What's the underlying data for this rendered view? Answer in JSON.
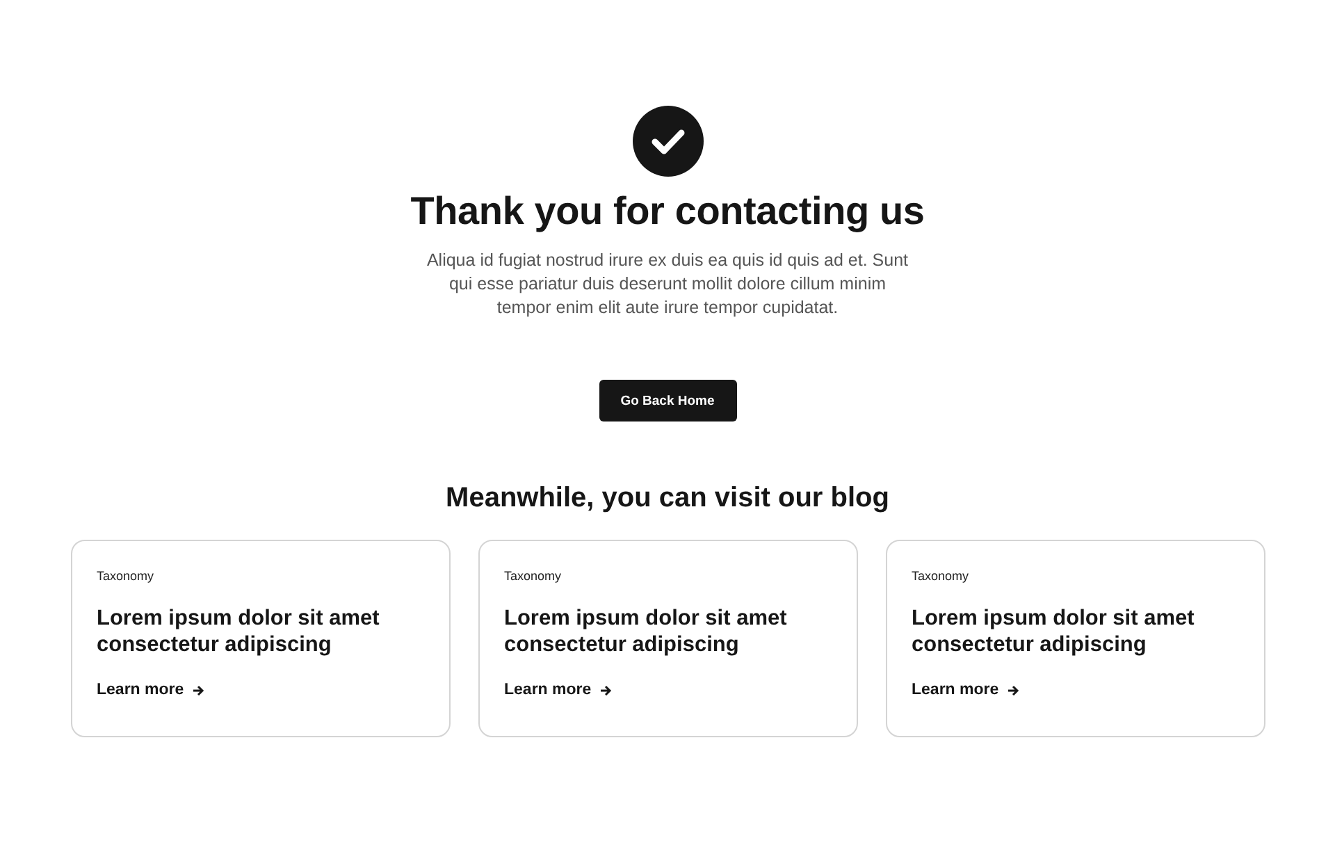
{
  "hero": {
    "title": "Thank you for contacting us",
    "message": "Aliqua id fugiat nostrud irure ex duis ea quis id quis ad et. Sunt qui esse pariatur duis deserunt mollit dolore cillum minim tempor enim elit aute irure tempor cupidatat.",
    "button": "Go Back Home"
  },
  "blog": {
    "heading": "Meanwhile, you can visit our blog",
    "cards": [
      {
        "category": "Taxonomy",
        "title": "Lorem ipsum dolor sit amet consectetur adipiscing",
        "link": "Learn more"
      },
      {
        "category": "Taxonomy",
        "title": "Lorem ipsum dolor sit amet consectetur adipiscing",
        "link": "Learn more"
      },
      {
        "category": "Taxonomy",
        "title": "Lorem ipsum dolor sit amet consectetur adipiscing",
        "link": "Learn more"
      }
    ]
  }
}
